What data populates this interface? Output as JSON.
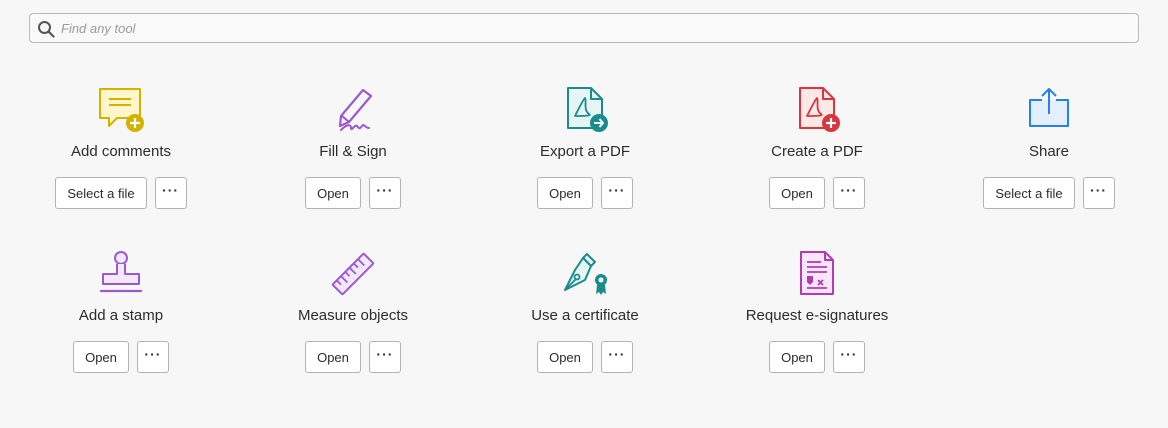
{
  "search": {
    "placeholder": "Find any tool",
    "value": ""
  },
  "tools": [
    {
      "label": "Add comments",
      "primary": "Select a file",
      "more": "···",
      "icon": "comment-add-icon",
      "color": "#d4b200"
    },
    {
      "label": "Fill & Sign",
      "primary": "Open",
      "more": "···",
      "icon": "fill-sign-icon",
      "color": "#9b59d0"
    },
    {
      "label": "Export a PDF",
      "primary": "Open",
      "more": "···",
      "icon": "export-pdf-icon",
      "color": "#1a8c8c"
    },
    {
      "label": "Create a PDF",
      "primary": "Open",
      "more": "···",
      "icon": "create-pdf-icon",
      "color": "#d9363e"
    },
    {
      "label": "Share",
      "primary": "Select a file",
      "more": "···",
      "icon": "share-icon",
      "color": "#2680eb"
    },
    {
      "label": "Add a stamp",
      "primary": "Open",
      "more": "···",
      "icon": "stamp-icon",
      "color": "#9b59d0"
    },
    {
      "label": "Measure objects",
      "primary": "Open",
      "more": "···",
      "icon": "ruler-icon",
      "color": "#9b59d0"
    },
    {
      "label": "Use a certificate",
      "primary": "Open",
      "more": "···",
      "icon": "certificate-pen-icon",
      "color": "#1a8c8c"
    },
    {
      "label": "Request e-signatures",
      "primary": "Open",
      "more": "···",
      "icon": "e-signature-document-icon",
      "color": "#b13bb0"
    }
  ]
}
